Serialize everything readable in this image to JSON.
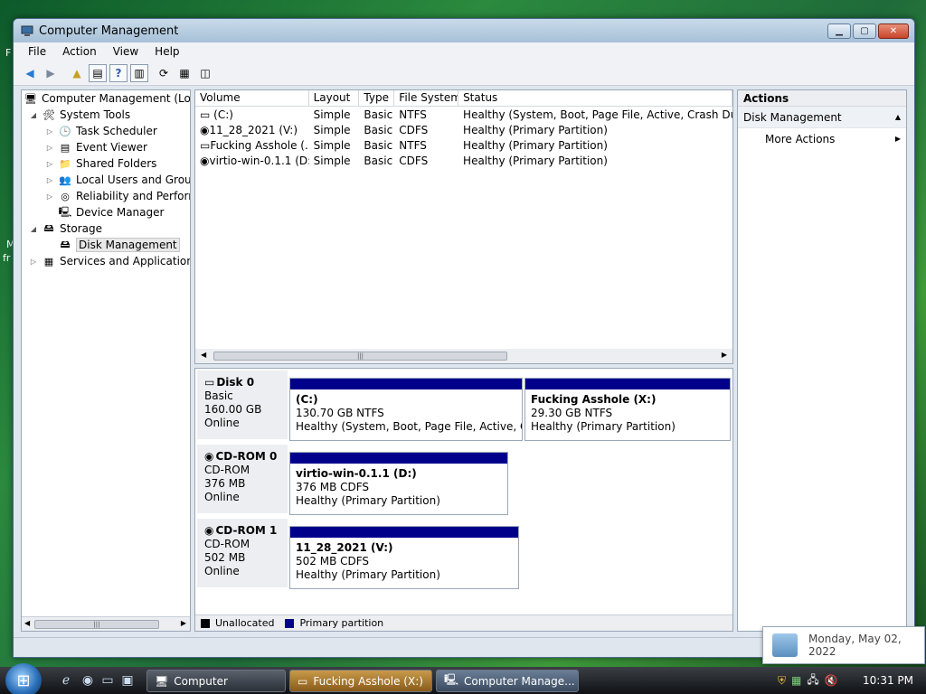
{
  "desktop": {
    "frag_top": "F",
    "frag_mid1": "M",
    "frag_mid2": "fr"
  },
  "window": {
    "title": "Computer Management",
    "menu": [
      "File",
      "Action",
      "View",
      "Help"
    ]
  },
  "tree": {
    "root": "Computer Management (Local",
    "system_tools": "System Tools",
    "task_scheduler": "Task Scheduler",
    "event_viewer": "Event Viewer",
    "shared_folders": "Shared Folders",
    "local_users": "Local Users and Groups",
    "reliability": "Reliability and Performa",
    "device_manager": "Device Manager",
    "storage": "Storage",
    "disk_management": "Disk Management",
    "services_apps": "Services and Applications"
  },
  "volumes": {
    "headers": [
      "Volume",
      "Layout",
      "Type",
      "File System",
      "Status"
    ],
    "rows": [
      {
        "volume": "(C:)",
        "layout": "Simple",
        "type": "Basic",
        "fs": "NTFS",
        "status": "Healthy (System, Boot, Page File, Active, Crash Dump, Pri"
      },
      {
        "volume": "11_28_2021 (V:)",
        "layout": "Simple",
        "type": "Basic",
        "fs": "CDFS",
        "status": "Healthy (Primary Partition)"
      },
      {
        "volume": "Fucking Asshole (...",
        "layout": "Simple",
        "type": "Basic",
        "fs": "NTFS",
        "status": "Healthy (Primary Partition)"
      },
      {
        "volume": "virtio-win-0.1.1 (D:)",
        "layout": "Simple",
        "type": "Basic",
        "fs": "CDFS",
        "status": "Healthy (Primary Partition)"
      }
    ]
  },
  "disks": [
    {
      "name": "Disk 0",
      "type": "Basic",
      "size": "160.00 GB",
      "state": "Online",
      "parts": [
        {
          "name": "(C:)",
          "size": "130.70 GB NTFS",
          "status": "Healthy (System, Boot, Page File, Active, Crash"
        },
        {
          "name": "Fucking Asshole  (X:)",
          "size": "29.30 GB NTFS",
          "status": "Healthy (Primary Partition)"
        }
      ]
    },
    {
      "name": "CD-ROM 0",
      "type": "CD-ROM",
      "size": "376 MB",
      "state": "Online",
      "parts": [
        {
          "name": "virtio-win-0.1.1  (D:)",
          "size": "376 MB CDFS",
          "status": "Healthy (Primary Partition)"
        }
      ]
    },
    {
      "name": "CD-ROM 1",
      "type": "CD-ROM",
      "size": "502 MB",
      "state": "Online",
      "parts": [
        {
          "name": "11_28_2021  (V:)",
          "size": "502 MB CDFS",
          "status": "Healthy (Primary Partition)"
        }
      ]
    }
  ],
  "legend": {
    "unallocated": "Unallocated",
    "primary": "Primary partition",
    "unallocated_color": "#000000",
    "primary_color": "#00008b"
  },
  "actions": {
    "header": "Actions",
    "section": "Disk Management",
    "more": "More Actions"
  },
  "taskbar": {
    "tasks": [
      "Computer",
      "Fucking Asshole (X:)",
      "Computer Manage..."
    ],
    "clock": "10:31 PM"
  },
  "tooltip": {
    "date": "Monday, May 02, 2022"
  }
}
